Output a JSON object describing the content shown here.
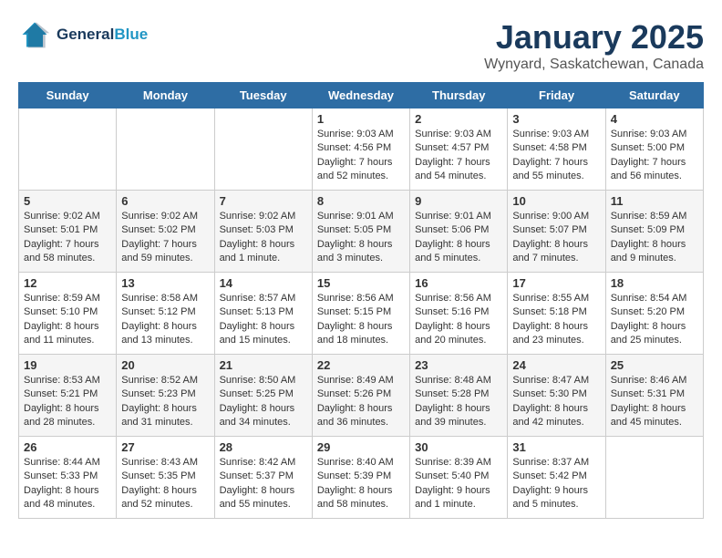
{
  "header": {
    "logo_line1": "General",
    "logo_line2": "Blue",
    "title": "January 2025",
    "subtitle": "Wynyard, Saskatchewan, Canada"
  },
  "days_of_week": [
    "Sunday",
    "Monday",
    "Tuesday",
    "Wednesday",
    "Thursday",
    "Friday",
    "Saturday"
  ],
  "weeks": [
    {
      "days": [
        {
          "num": "",
          "info": ""
        },
        {
          "num": "",
          "info": ""
        },
        {
          "num": "",
          "info": ""
        },
        {
          "num": "1",
          "info": "Sunrise: 9:03 AM\nSunset: 4:56 PM\nDaylight: 7 hours and 52 minutes."
        },
        {
          "num": "2",
          "info": "Sunrise: 9:03 AM\nSunset: 4:57 PM\nDaylight: 7 hours and 54 minutes."
        },
        {
          "num": "3",
          "info": "Sunrise: 9:03 AM\nSunset: 4:58 PM\nDaylight: 7 hours and 55 minutes."
        },
        {
          "num": "4",
          "info": "Sunrise: 9:03 AM\nSunset: 5:00 PM\nDaylight: 7 hours and 56 minutes."
        }
      ]
    },
    {
      "days": [
        {
          "num": "5",
          "info": "Sunrise: 9:02 AM\nSunset: 5:01 PM\nDaylight: 7 hours and 58 minutes."
        },
        {
          "num": "6",
          "info": "Sunrise: 9:02 AM\nSunset: 5:02 PM\nDaylight: 7 hours and 59 minutes."
        },
        {
          "num": "7",
          "info": "Sunrise: 9:02 AM\nSunset: 5:03 PM\nDaylight: 8 hours and 1 minute."
        },
        {
          "num": "8",
          "info": "Sunrise: 9:01 AM\nSunset: 5:05 PM\nDaylight: 8 hours and 3 minutes."
        },
        {
          "num": "9",
          "info": "Sunrise: 9:01 AM\nSunset: 5:06 PM\nDaylight: 8 hours and 5 minutes."
        },
        {
          "num": "10",
          "info": "Sunrise: 9:00 AM\nSunset: 5:07 PM\nDaylight: 8 hours and 7 minutes."
        },
        {
          "num": "11",
          "info": "Sunrise: 8:59 AM\nSunset: 5:09 PM\nDaylight: 8 hours and 9 minutes."
        }
      ]
    },
    {
      "days": [
        {
          "num": "12",
          "info": "Sunrise: 8:59 AM\nSunset: 5:10 PM\nDaylight: 8 hours and 11 minutes."
        },
        {
          "num": "13",
          "info": "Sunrise: 8:58 AM\nSunset: 5:12 PM\nDaylight: 8 hours and 13 minutes."
        },
        {
          "num": "14",
          "info": "Sunrise: 8:57 AM\nSunset: 5:13 PM\nDaylight: 8 hours and 15 minutes."
        },
        {
          "num": "15",
          "info": "Sunrise: 8:56 AM\nSunset: 5:15 PM\nDaylight: 8 hours and 18 minutes."
        },
        {
          "num": "16",
          "info": "Sunrise: 8:56 AM\nSunset: 5:16 PM\nDaylight: 8 hours and 20 minutes."
        },
        {
          "num": "17",
          "info": "Sunrise: 8:55 AM\nSunset: 5:18 PM\nDaylight: 8 hours and 23 minutes."
        },
        {
          "num": "18",
          "info": "Sunrise: 8:54 AM\nSunset: 5:20 PM\nDaylight: 8 hours and 25 minutes."
        }
      ]
    },
    {
      "days": [
        {
          "num": "19",
          "info": "Sunrise: 8:53 AM\nSunset: 5:21 PM\nDaylight: 8 hours and 28 minutes."
        },
        {
          "num": "20",
          "info": "Sunrise: 8:52 AM\nSunset: 5:23 PM\nDaylight: 8 hours and 31 minutes."
        },
        {
          "num": "21",
          "info": "Sunrise: 8:50 AM\nSunset: 5:25 PM\nDaylight: 8 hours and 34 minutes."
        },
        {
          "num": "22",
          "info": "Sunrise: 8:49 AM\nSunset: 5:26 PM\nDaylight: 8 hours and 36 minutes."
        },
        {
          "num": "23",
          "info": "Sunrise: 8:48 AM\nSunset: 5:28 PM\nDaylight: 8 hours and 39 minutes."
        },
        {
          "num": "24",
          "info": "Sunrise: 8:47 AM\nSunset: 5:30 PM\nDaylight: 8 hours and 42 minutes."
        },
        {
          "num": "25",
          "info": "Sunrise: 8:46 AM\nSunset: 5:31 PM\nDaylight: 8 hours and 45 minutes."
        }
      ]
    },
    {
      "days": [
        {
          "num": "26",
          "info": "Sunrise: 8:44 AM\nSunset: 5:33 PM\nDaylight: 8 hours and 48 minutes."
        },
        {
          "num": "27",
          "info": "Sunrise: 8:43 AM\nSunset: 5:35 PM\nDaylight: 8 hours and 52 minutes."
        },
        {
          "num": "28",
          "info": "Sunrise: 8:42 AM\nSunset: 5:37 PM\nDaylight: 8 hours and 55 minutes."
        },
        {
          "num": "29",
          "info": "Sunrise: 8:40 AM\nSunset: 5:39 PM\nDaylight: 8 hours and 58 minutes."
        },
        {
          "num": "30",
          "info": "Sunrise: 8:39 AM\nSunset: 5:40 PM\nDaylight: 9 hours and 1 minute."
        },
        {
          "num": "31",
          "info": "Sunrise: 8:37 AM\nSunset: 5:42 PM\nDaylight: 9 hours and 5 minutes."
        },
        {
          "num": "",
          "info": ""
        }
      ]
    }
  ]
}
